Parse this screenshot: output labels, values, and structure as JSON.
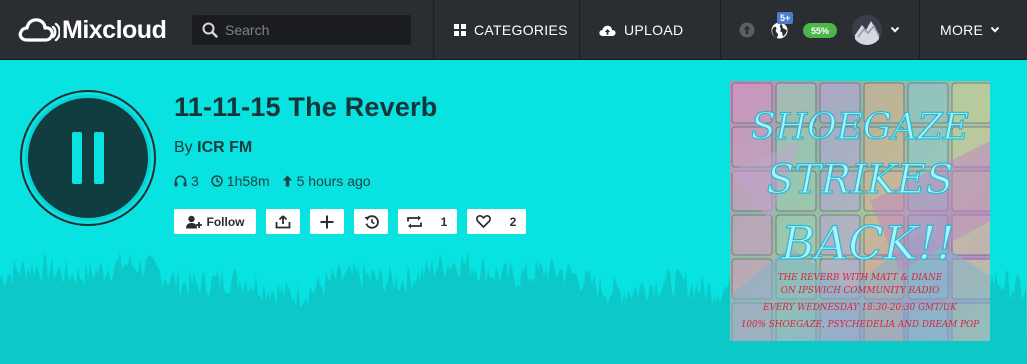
{
  "header": {
    "brand": "Mixcloud",
    "search_placeholder": "Search",
    "categories_label": "CATEGORIES",
    "upload_label": "UPLOAD",
    "notifications_badge": "5+",
    "progress_badge": "55%",
    "more_label": "MORE"
  },
  "show": {
    "title": "11-11-15 The Reverb",
    "by_prefix": "By",
    "owner": "ICR FM",
    "plays": "3",
    "duration": "1h58m",
    "uploaded": "5 hours ago"
  },
  "actions": {
    "follow_label": "Follow",
    "repost_count": "1",
    "favorite_count": "2"
  },
  "artwork": {
    "headline_1": "SHOEGAZE",
    "headline_2": "STRIKES",
    "headline_3": "BACK!!",
    "line_1": "THE REVERB WITH MATT & DIANE",
    "line_2": "ON IPSWICH COMMUNITY RADIO",
    "line_3": "EVERY WEDNESDAY 18:30-20:30 GMT/UK",
    "line_4": "100% SHOEGAZE, PSYCHEDELIA AND DREAM POP"
  },
  "colors": {
    "player_bg": "#08e2e0",
    "topbar_bg": "#2a2d31",
    "waveform": "#0cc9c7",
    "badge_blue": "#4a7bd1",
    "badge_green": "#4cb84c"
  }
}
